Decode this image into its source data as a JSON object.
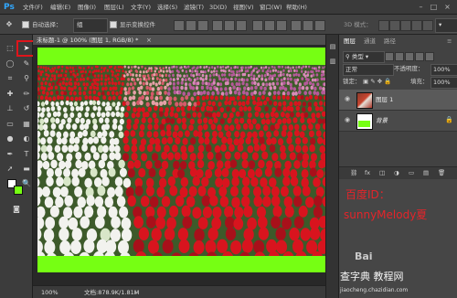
{
  "app": {
    "logo": "Ps"
  },
  "menubar": {
    "items": [
      "文件(F)",
      "编辑(E)",
      "图像(I)",
      "图层(L)",
      "文字(Y)",
      "选择(S)",
      "滤镜(T)",
      "3D(D)",
      "视图(V)",
      "窗口(W)",
      "帮助(H)"
    ]
  },
  "options": {
    "auto_select_label": "自动选择：",
    "auto_select_value": "组",
    "show_transform_label": "显示变换控件",
    "mode_3d_label": "3D 模式："
  },
  "document": {
    "tab_title": "未标题-1 @ 100% (图层 1, RGB/8) *",
    "zoom": "100%",
    "doc_info": "文档:878.9K/1.81M",
    "canvas_color": "#76ff13"
  },
  "panels": {
    "tabs": [
      "图层",
      "通道",
      "路径"
    ],
    "kind_label": "类型",
    "blend_mode": "正常",
    "opacity_label": "不透明度：",
    "opacity_value": "100%",
    "lock_label": "锁定：",
    "fill_label": "填充：",
    "fill_value": "100%",
    "layers": [
      {
        "name": "图层 1",
        "type": "photo",
        "selected": true
      },
      {
        "name": "背景",
        "type": "green",
        "selected": false
      }
    ]
  },
  "watermark": {
    "line1": "百度ID：",
    "line2": "sunnyMelody夏",
    "line3": "Bai",
    "line4": "查字典 教程网",
    "line5": "jiaocheng.chazidian.com"
  },
  "colors": {
    "accent_red": "#e0141b",
    "canvas_green": "#76ff13",
    "ui_dark": "#3c3c3c"
  },
  "icons": [
    "move-tool-icon",
    "marquee-icon",
    "lasso-icon",
    "crop-icon",
    "eyedropper-icon",
    "brush-icon",
    "eye-icon",
    "lock-icon",
    "link-icon",
    "trash-icon"
  ]
}
